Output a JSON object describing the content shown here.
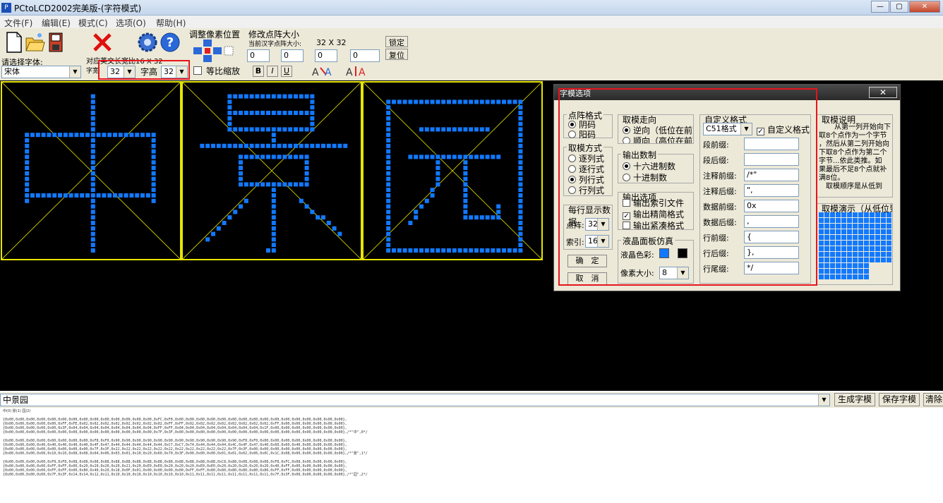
{
  "window": {
    "title": "PCtoLCD2002完美版-(字符模式)",
    "icon": "P",
    "min": "—",
    "max": "▢",
    "close": "✕"
  },
  "menu": [
    "文件(F)",
    "编辑(E)",
    "模式(C)",
    "选项(O)",
    "帮助(H)"
  ],
  "toolbar": {
    "font_label": "请选择字体:",
    "font_value": "宋体",
    "ratio_label": "对应英文长宽比16 X 32",
    "width_label": "字宽",
    "width_value": "32",
    "height_label": "字高",
    "height_value": "32",
    "equal_scale_label": "等比缩放",
    "bold": "B",
    "italic": "I",
    "underline": "U",
    "adjust_label": "调整像素位置",
    "dot_size_label": "修改点阵大小",
    "current_dot_label": "当前汉字点阵大小:",
    "current_dot_value": "32 X 32",
    "lock_label": "锁定",
    "reset_label": "复位",
    "spin_values": [
      "0",
      "0",
      "0",
      "0"
    ],
    "icons": [
      "new-file-icon",
      "open-folder-icon",
      "save-disk-icon",
      "delete-x-icon",
      "settings-gear-icon",
      "help-question-icon"
    ]
  },
  "canvas": {
    "glyphs": [
      "中",
      "景",
      "园"
    ],
    "dot_color": "#1279ff",
    "grid_color": "#e6e600"
  },
  "dialog": {
    "title": "字模选项",
    "close": "✕",
    "dot_format": {
      "title": "点阵格式",
      "options": [
        "阴码",
        "阳码"
      ],
      "selected": 0
    },
    "mold_mode": {
      "title": "取模方式",
      "options": [
        "逐列式",
        "逐行式",
        "列行式",
        "行列式"
      ],
      "selected": 2
    },
    "per_row": {
      "title": "每行显示数据",
      "dot_label": "点阵:",
      "dot_value": "32",
      "index_label": "索引:",
      "index_value": "16"
    },
    "ok": "确　定",
    "cancel": "取　消",
    "direction": {
      "title": "取模走向",
      "options": [
        "逆向（低位在前）",
        "顺向（高位在前）"
      ],
      "selected": 0
    },
    "radix": {
      "title": "输出数制",
      "options": [
        "十六进制数",
        "十进制数"
      ],
      "selected": 0
    },
    "output_opts": {
      "title": "输出选项",
      "options": [
        "输出索引文件",
        "输出精简格式",
        "输出紧凑格式"
      ],
      "checked": [
        false,
        true,
        false
      ]
    },
    "lcd_sim": {
      "title": "液晶面板仿真",
      "color_label": "液晶色彩:",
      "pixel_label": "像素大小:",
      "pixel_value": "8",
      "color_on": "#1279ff",
      "color_off": "#000000"
    },
    "custom": {
      "title": "自定义格式",
      "format_value": "C51格式",
      "custom_check_label": "自定义格式",
      "fields": [
        {
          "label": "段前缀:",
          "value": ""
        },
        {
          "label": "段后缀:",
          "value": ""
        },
        {
          "label": "注释前缀:",
          "value": "/*\""
        },
        {
          "label": "注释后缀:",
          "value": "\","
        },
        {
          "label": "数据前缀:",
          "value": "0x"
        },
        {
          "label": "数据后缀:",
          "value": ","
        },
        {
          "label": "行前缀:",
          "value": "{"
        },
        {
          "label": "行后缀:",
          "value": "},"
        },
        {
          "label": "行尾缀:",
          "value": "*/"
        }
      ]
    },
    "explain": {
      "title": "取模说明",
      "text": [
        "从第一列开始向下",
        "取8个点作为一个字节",
        "，然后从第二列开始向",
        "下取8个点作为第二个",
        "字节...依此类推。如",
        "果最后不足8个点就补",
        "满8位。",
        "取模顺序是从低到"
      ]
    },
    "demo": {
      "title": "取模演示（从低位到"
    }
  },
  "bottom": {
    "input_value": "中景园",
    "generate": "生成字模",
    "save": "保存字模",
    "clear": "清除字模"
  },
  "output": {
    "index_line": "中(0) 景(1) 园(2)",
    "lines": [
      "{0x00,0x00,0x00,0x00,0x00,0x00,0x00,0x00,0x00,0x00,0x00,0x00,0x00,0x00,0xFC,0xF8,0x00,0x00,0x00,0x00,0x00,0x00,0x00,0x00,0x00,0x00,0x00,0x00,0x00,0x00,0x00,0x00},",
      "{0x00,0x00,0x00,0x00,0x00,0xFF,0xFE,0x02,0x02,0x02,0x02,0x02,0x02,0x02,0x02,0xFF,0xFF,0x02,0x02,0x02,0x02,0x02,0x02,0x02,0x02,0xFF,0x00,0x00,0x00,0x00,0x00,0x00},",
      "{0x00,0x00,0x00,0x00,0x00,0x3F,0x04,0x04,0x04,0x04,0x04,0x04,0x04,0x04,0xFF,0xFF,0x04,0x04,0x04,0x04,0x04,0x04,0x04,0x04,0x1F,0x00,0x00,0x00,0x00,0x00,0x00,0x00},",
      "{0x00,0x00,0x00,0x00,0x00,0x00,0x00,0x00,0x00,0x00,0x00,0x00,0x00,0x00,0x7F,0x3F,0x00,0x00,0x00,0x00,0x00,0x00,0x00,0x00,0x00,0x00,0x00,0x00,0x00,0x00,0x00,0x00},/*\"中\",0*/",
      "",
      "{0x00,0x00,0x00,0x00,0x00,0x00,0x00,0x00,0xF8,0xF0,0x90,0x90,0x90,0x90,0x90,0x90,0x90,0x90,0x90,0x90,0x90,0x90,0xF8,0xF0,0x00,0x00,0x00,0x00,0x00,0x00,0x00,0x00},",
      "{0x00,0x00,0x00,0x40,0x40,0x40,0x40,0x40,0x4F,0x47,0x44,0x44,0x44,0x44,0x44,0xC7,0xC7,0x74,0x44,0x44,0x44,0x4C,0x4F,0x47,0x40,0x60,0x60,0x40,0x00,0x00,0x00,0x00},",
      "{0x00,0x00,0x00,0x00,0x00,0x00,0x00,0x00,0x7F,0x3F,0x22,0x22,0x22,0x22,0x22,0x22,0x22,0x22,0x22,0x22,0x22,0x7F,0x3F,0x00,0x00,0x00,0x00,0x00,0x00,0x00,0x00,0x00},",
      "{0x00,0x00,0x00,0x00,0x10,0x10,0x08,0x08,0x04,0x06,0x03,0x01,0x10,0x20,0x60,0x70,0x3F,0x00,0x00,0x00,0x01,0x01,0x02,0x06,0x0C,0x1C,0x08,0x00,0x00,0x00,0x00,0x00},/*\"景\",1*/",
      "",
      "{0x00,0x00,0x00,0x00,0xF8,0xF8,0x08,0x08,0x08,0x88,0x88,0x88,0x88,0x88,0x88,0x88,0x88,0x88,0x88,0x88,0xC8,0x88,0x08,0x08,0x08,0xF8,0xFC,0x08,0x00,0x00,0x00,0x00},",
      "{0x00,0x00,0x00,0x00,0xFF,0xFF,0x00,0x20,0x20,0x20,0x20,0x21,0x20,0xE0,0xE0,0x20,0x20,0x20,0xE0,0xE0,0x20,0x20,0x20,0x20,0x20,0x40,0xFF,0x00,0x00,0x00,0x00,0x00},",
      "{0x00,0x00,0x00,0x00,0xFF,0xFF,0x00,0x80,0x40,0x20,0x18,0x0F,0x01,0x00,0x00,0x00,0x00,0xFF,0xFF,0x80,0x80,0x80,0x80,0x80,0x80,0xFF,0xFF,0x00,0x00,0x00,0x00,0x00},",
      "{0x00,0x00,0x00,0x00,0x7F,0x3F,0x14,0x14,0x12,0x11,0x10,0x10,0x10,0x10,0x10,0x10,0x10,0x11,0x11,0x11,0x11,0x11,0x11,0x11,0x11,0x7F,0x3F,0x00,0x00,0x00,0x00,0x00},/*\"园\",2*/"
    ]
  }
}
